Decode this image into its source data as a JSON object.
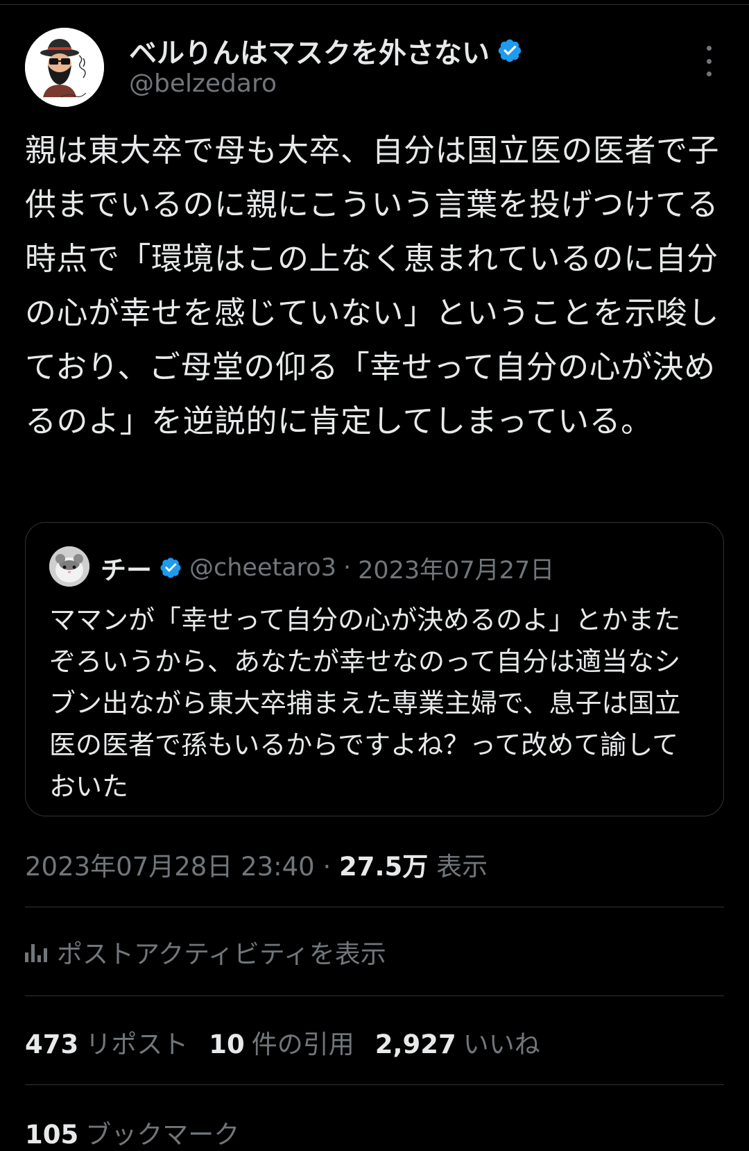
{
  "author": {
    "display_name": "ベルりんはマスクを外さない",
    "handle": "@belzedaro",
    "avatar_icon": "avatar-icon"
  },
  "tweet": {
    "text": "親は東大卒で母も大卒、自分は国立医の医者で子供までいるのに親にこういう言葉を投げつけてる時点で「環境はこの上なく恵まれているのに自分の心が幸せを感じていない」ということを示唆しており、ご母堂の仰る「幸せって自分の心が決めるのよ」を逆説的に肯定してしまっている。",
    "timestamp": "2023年07月28日 23:40",
    "separator": "·",
    "views_count": "27.5万",
    "views_label": "表示"
  },
  "quoted": {
    "display_name": "チー",
    "handle": "@cheetaro3",
    "separator": "·",
    "date": "2023年07月27日",
    "text": "ママンが「幸せって自分の心が決めるのよ」とかまたぞろいうから、あなたが幸せなのって自分は適当なシブン出ながら東大卒捕まえた専業主婦で、息子は国立医の医者で孫もいるからですよね？って改めて諭しておいた"
  },
  "activity": {
    "label": "ポストアクティビティを表示"
  },
  "stats": {
    "reposts_count": "473",
    "reposts_label": "リポスト",
    "quotes_count": "10",
    "quotes_label": "件の引用",
    "likes_count": "2,927",
    "likes_label": "いいね",
    "bookmarks_count": "105",
    "bookmarks_label": "ブックマーク"
  },
  "colors": {
    "background": "#000000",
    "text_primary": "#e7e9ea",
    "text_secondary": "#71767b",
    "divider": "#2f3336",
    "verified_badge": "#1d9bf0"
  }
}
